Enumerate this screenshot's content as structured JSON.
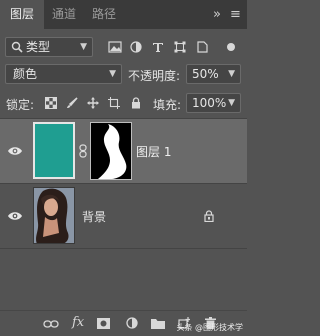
{
  "tabs": [
    {
      "label": "图层"
    },
    {
      "label": "通道"
    },
    {
      "label": "路径"
    }
  ],
  "tab_menu": {
    "more": "»",
    "menu": "≡"
  },
  "filter": {
    "kind_label": "类型"
  },
  "blend": {
    "mode": "颜色",
    "opacity_label": "不透明度:",
    "opacity_value": "50%"
  },
  "lock": {
    "label": "锁定:",
    "fill_label": "填充:",
    "fill_value": "100%"
  },
  "layers": [
    {
      "name": "图层 1",
      "selected": true
    },
    {
      "name": "背景",
      "locked": true
    }
  ],
  "bottom": {
    "fx_label": "fx",
    "watermark": "头条 @图形技术学"
  },
  "colors": {
    "teal": "#1f9e91",
    "panel": "#535353",
    "tabbar": "#3a3a3a",
    "selected": "#6a6a6a"
  }
}
